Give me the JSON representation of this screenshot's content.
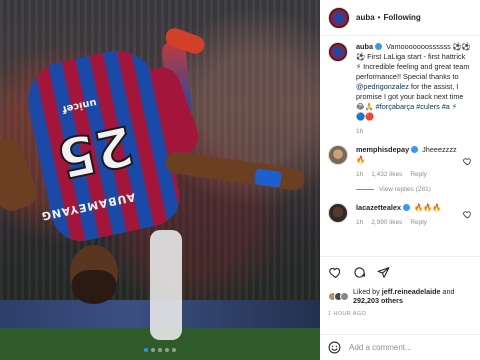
{
  "post": {
    "author": "auba",
    "follow_status": "Following",
    "separator": "•"
  },
  "comments": [
    {
      "user": "auba",
      "text_parts": [
        "Vamooooooossssss ⚽⚽⚽ First LaLiga start - first hattrick ⚡ Incredible feeling and great team performance!! Special thanks to ",
        "@pedrigonzalez",
        " for the assist, I promise I got your back next time 😂🙏 ",
        "#forçabarça #culers #a ⚡",
        " 🔵🔴"
      ],
      "time": "1h"
    },
    {
      "user": "memphisdepay",
      "text": "Jheeezzzz 🔥",
      "time": "1h",
      "likes": "1,432 likes",
      "reply": "Reply"
    },
    {
      "user": "lacazettealex",
      "text": "🔥🔥🔥",
      "time": "1h",
      "likes": "2,990 likes",
      "reply": "Reply"
    }
  ],
  "view_replies": "View replies (281)",
  "liked_by": {
    "prefix": "Liked by ",
    "user": "jeff.reineadelaide",
    "middle": " and ",
    "count": "292,203 others"
  },
  "time_ago": "1 HOUR AGO",
  "add_comment_placeholder": "Add a comment...",
  "photo": {
    "shirt_number": "25",
    "shirt_name": "AUBAMEYANG",
    "shirt_sponsor": "unicef"
  },
  "carousel": {
    "count": 5,
    "active_index": 0
  },
  "colors": {
    "verified": "#3897f0",
    "mention": "#00376b",
    "meta_gray": "#8e8e8e"
  }
}
